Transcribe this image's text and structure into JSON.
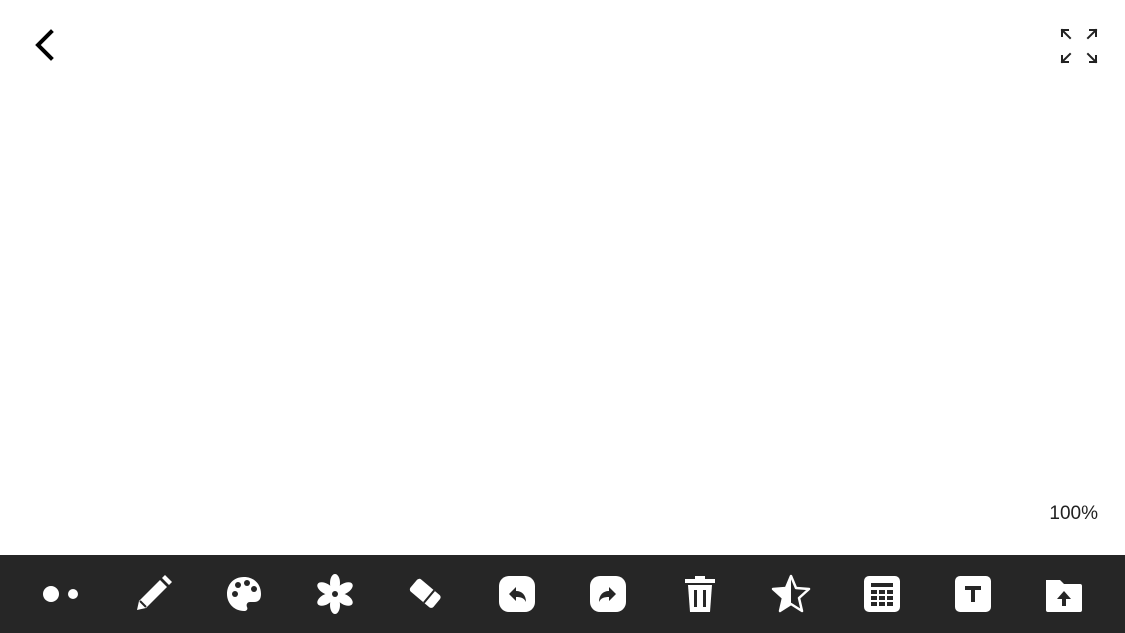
{
  "canvas": {
    "zoom_label": "100%"
  },
  "toolbar": {
    "tools": [
      {
        "id": "brush-size",
        "icon": "dots-icon"
      },
      {
        "id": "pencil",
        "icon": "pencil-icon"
      },
      {
        "id": "palette",
        "icon": "palette-icon"
      },
      {
        "id": "effects",
        "icon": "asterisk-icon"
      },
      {
        "id": "eraser",
        "icon": "eraser-icon"
      },
      {
        "id": "undo",
        "icon": "undo-icon"
      },
      {
        "id": "redo",
        "icon": "redo-icon"
      },
      {
        "id": "delete",
        "icon": "trash-icon"
      },
      {
        "id": "stamp",
        "icon": "star-half-icon"
      },
      {
        "id": "grid",
        "icon": "grid-icon"
      },
      {
        "id": "text",
        "icon": "text-icon"
      },
      {
        "id": "upload",
        "icon": "upload-folder-icon"
      }
    ]
  },
  "colors": {
    "toolbar_bg": "#262626",
    "icon": "#ffffff",
    "canvas_bg": "#ffffff"
  }
}
